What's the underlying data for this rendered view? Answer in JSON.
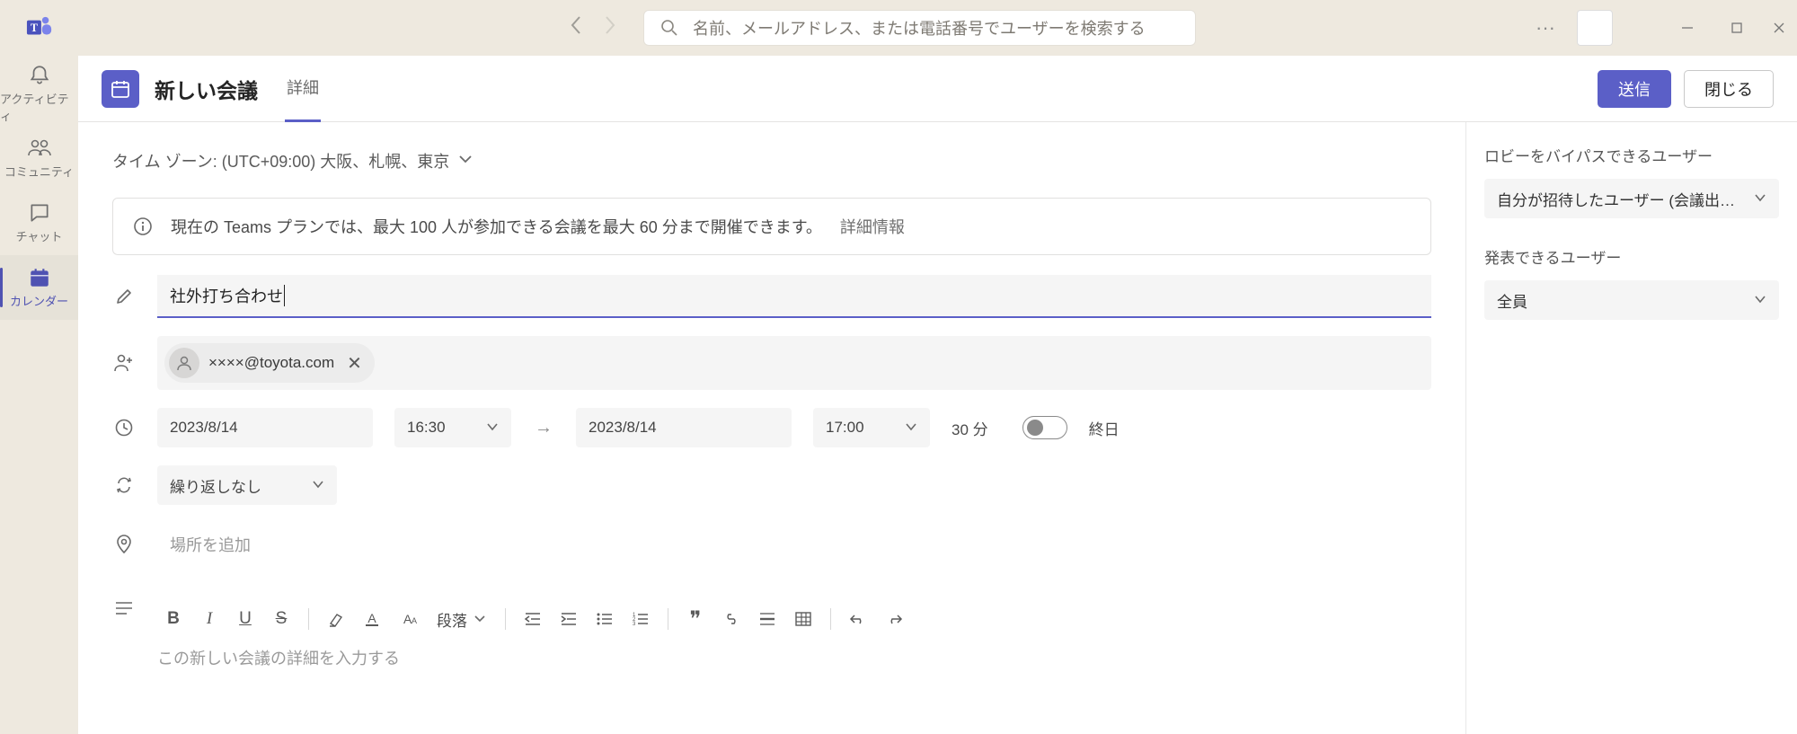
{
  "search": {
    "placeholder": "名前、メールアドレス、または電話番号でユーザーを検索する"
  },
  "rail": {
    "activity": "アクティビティ",
    "community": "コミュニティ",
    "chat": "チャット",
    "calendar": "カレンダー"
  },
  "cmdbar": {
    "title": "新しい会議",
    "tab_details": "詳細",
    "send": "送信",
    "close": "閉じる"
  },
  "timezone": {
    "label": "タイム ゾーン: (UTC+09:00) 大阪、札幌、東京"
  },
  "banner": {
    "message": "現在の Teams プランでは、最大 100 人が参加できる会議を最大 60 分まで開催できます。",
    "link": "詳細情報"
  },
  "form": {
    "title_value": "社外打ち合わせ",
    "attendee_email": "××××@toyota.com",
    "date_start": "2023/8/14",
    "time_start": "16:30",
    "date_end": "2023/8/14",
    "time_end": "17:00",
    "duration": "30 分",
    "allday_label": "終日",
    "recurrence": "繰り返しなし",
    "location_placeholder": "場所を追加",
    "paragraph_style": "段落",
    "description_placeholder": "この新しい会議の詳細を入力する"
  },
  "side": {
    "lobby_label": "ロビーをバイパスできるユーザー",
    "lobby_value": "自分が招待したユーザー (会議出席...",
    "presenter_label": "発表できるユーザー",
    "presenter_value": "全員"
  }
}
